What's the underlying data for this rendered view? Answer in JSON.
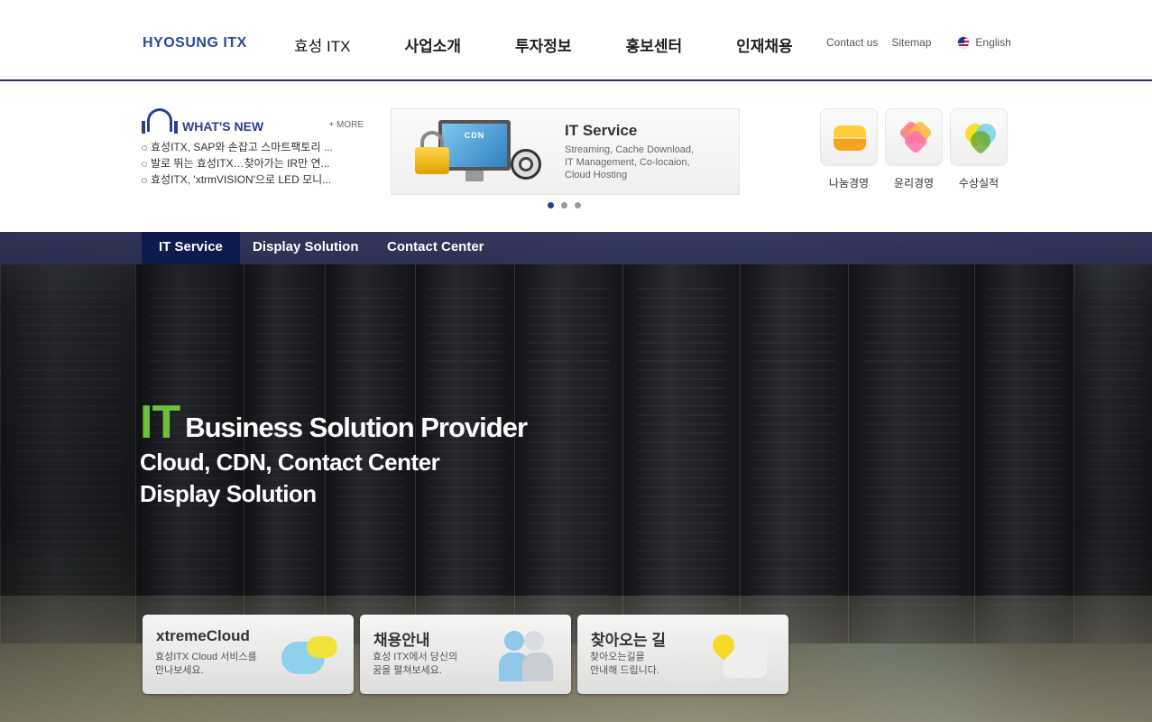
{
  "header": {
    "logo": "HYOSUNG ITX",
    "nav": [
      "효성 ITX",
      "사업소개",
      "투자정보",
      "홍보센터",
      "인재채용"
    ],
    "util": {
      "contact": "Contact us",
      "sitemap": "Sitemap",
      "language": "English"
    }
  },
  "news": {
    "title": "WHAT'S NEW",
    "more": "+ MORE",
    "items": [
      "효성ITX, SAP와 손잡고 스마트팩토리 ...",
      "발로 뛰는 효성ITX…찾아가는 IR만 연...",
      "효성ITX, 'xtrmVISION'으로 LED 모니..."
    ]
  },
  "banner": {
    "screen_label": "CDN",
    "title": "IT Service",
    "desc": "Streaming, Cache Download,\nIT Management, Co-locaion,\nCloud Hosting",
    "slides": 3,
    "active_slide": 1
  },
  "quick_links": [
    {
      "label": "나눔경영",
      "icon": "sharing-icon"
    },
    {
      "label": "윤리경영",
      "icon": "ethics-icon"
    },
    {
      "label": "수상실적",
      "icon": "award-icon"
    }
  ],
  "hero": {
    "tabs": [
      "IT Service",
      "Display Solution",
      "Contact Center"
    ],
    "active_tab": "IT Service",
    "headline_accent": "IT",
    "headline": "Business Solution Provider",
    "sub1": "Cloud, CDN, Contact Center",
    "sub2": "Display Solution",
    "accent_color": "#6fbf3a"
  },
  "cards": [
    {
      "title": "xtremeCloud",
      "desc": "효성ITX Cloud 서비스를\n만나보세요."
    },
    {
      "title": "채용안내",
      "desc": "효성 ITX에서 당신의\n꿈을 펼쳐보세요."
    },
    {
      "title": "찾아오는 길",
      "desc": "찾아오는길을\n안내해 드립니다."
    }
  ],
  "colors": {
    "brand": "#2c3e8f",
    "tab_bar": "#1e2450",
    "active_tab": "#0f1a4d"
  }
}
